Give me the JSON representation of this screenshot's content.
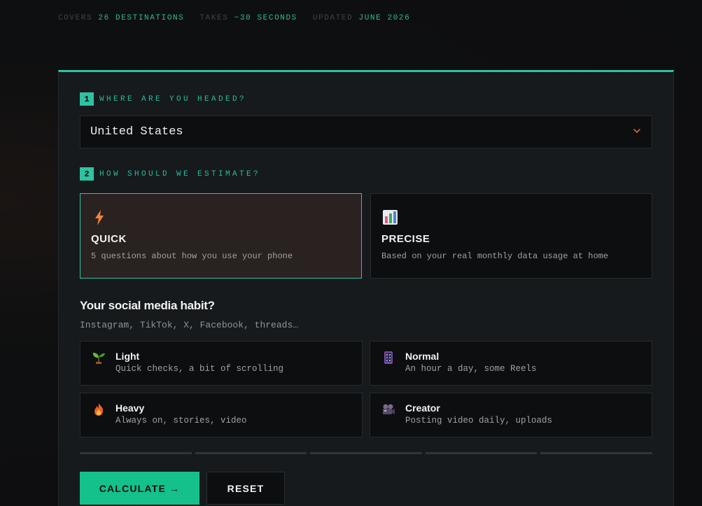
{
  "stats": [
    {
      "key": "COVERS",
      "value": "26 DESTINATIONS"
    },
    {
      "key": "TAKES",
      "value": "~30 SECONDS"
    },
    {
      "key": "UPDATED",
      "value": "JUNE 2026"
    }
  ],
  "step1": {
    "number": "1",
    "label": "WHERE ARE YOU HEADED?"
  },
  "destination": {
    "value": "United States",
    "icon": "chevron-down-icon"
  },
  "step2": {
    "number": "2",
    "label": "HOW SHOULD WE ESTIMATE?"
  },
  "modes": [
    {
      "title": "QUICK",
      "desc": "5 questions about how you use your phone",
      "icon": "lightning-icon",
      "selected": true
    },
    {
      "title": "PRECISE",
      "desc": "Based on your real monthly data usage at home",
      "icon": "bar-chart-icon",
      "selected": false
    }
  ],
  "question": {
    "title": "Your social media habit?",
    "subtitle": "Instagram, TikTok, X, Facebook, threads…"
  },
  "options": [
    {
      "title": "Light",
      "desc": "Quick checks, a bit of scrolling",
      "icon": "seedling-icon"
    },
    {
      "title": "Normal",
      "desc": "An hour a day, some Reels",
      "icon": "phone-icon"
    },
    {
      "title": "Heavy",
      "desc": "Always on, stories, video",
      "icon": "fire-icon"
    },
    {
      "title": "Creator",
      "desc": "Posting video daily, uploads",
      "icon": "video-camera-icon"
    }
  ],
  "progress": {
    "total_steps": 5,
    "completed": 0
  },
  "buttons": {
    "calculate": "CALCULATE →",
    "reset": "RESET"
  },
  "colors": {
    "accent": "#2ec3a2",
    "button": "#14c18a",
    "background": "#0e0f10",
    "card": "#161a1c"
  }
}
